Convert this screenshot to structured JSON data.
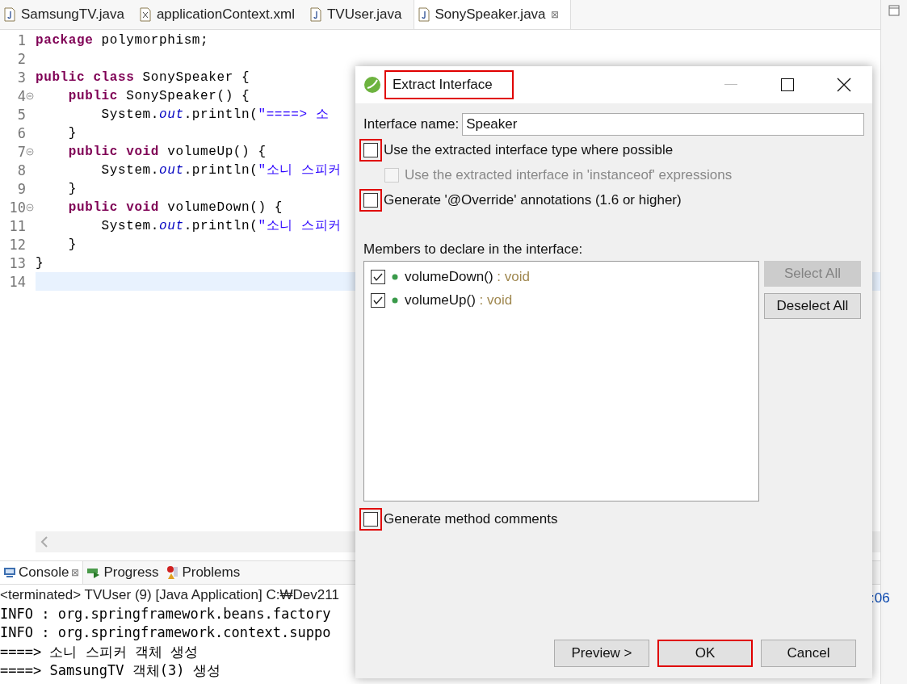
{
  "editor_tabs": [
    {
      "label": "SamsungTV.java",
      "kind": "java",
      "selected": false
    },
    {
      "label": "applicationContext.xml",
      "kind": "xml",
      "selected": false
    },
    {
      "label": "TVUser.java",
      "kind": "java",
      "selected": false
    },
    {
      "label": "SonySpeaker.java",
      "kind": "java",
      "selected": true,
      "close": "⊠"
    }
  ],
  "code_lines": [
    {
      "number": "1",
      "fold": false,
      "current": false,
      "tokens": [
        {
          "kind": "keyword",
          "text": "package"
        },
        {
          "kind": "plain",
          "text": " polymorphism;"
        }
      ]
    },
    {
      "number": "2",
      "fold": false,
      "current": false
    },
    {
      "number": "3",
      "fold": false,
      "current": false,
      "tokens": [
        {
          "kind": "keyword",
          "text": "public class"
        },
        {
          "kind": "plain",
          "text": " SonySpeaker {"
        }
      ]
    },
    {
      "number": "4",
      "fold": true,
      "current": false,
      "tokens": [
        {
          "kind": "keyword",
          "text": "    public"
        },
        {
          "kind": "plain",
          "text": " SonySpeaker() {"
        }
      ]
    },
    {
      "number": "5",
      "fold": false,
      "current": false,
      "tokens": [
        {
          "kind": "plain",
          "text": "        System."
        },
        {
          "kind": "field",
          "text": "out"
        },
        {
          "kind": "plain",
          "text": ".println("
        },
        {
          "kind": "string",
          "text": "\"====> 소"
        }
      ]
    },
    {
      "number": "6",
      "fold": false,
      "current": false,
      "tokens": [
        {
          "kind": "plain",
          "text": "    }"
        }
      ]
    },
    {
      "number": "7",
      "fold": true,
      "current": false,
      "tokens": [
        {
          "kind": "keyword",
          "text": "    public void"
        },
        {
          "kind": "plain",
          "text": " volumeUp() {"
        }
      ]
    },
    {
      "number": "8",
      "fold": false,
      "current": false,
      "tokens": [
        {
          "kind": "plain",
          "text": "        System."
        },
        {
          "kind": "field",
          "text": "out"
        },
        {
          "kind": "plain",
          "text": ".println("
        },
        {
          "kind": "string",
          "text": "\"소니 스피커"
        }
      ]
    },
    {
      "number": "9",
      "fold": false,
      "current": false,
      "tokens": [
        {
          "kind": "plain",
          "text": "    }"
        }
      ]
    },
    {
      "number": "10",
      "fold": true,
      "current": false,
      "tokens": [
        {
          "kind": "keyword",
          "text": "    public void"
        },
        {
          "kind": "plain",
          "text": " volumeDown() {"
        }
      ]
    },
    {
      "number": "11",
      "fold": false,
      "current": false,
      "tokens": [
        {
          "kind": "plain",
          "text": "        System."
        },
        {
          "kind": "field",
          "text": "out"
        },
        {
          "kind": "plain",
          "text": ".println("
        },
        {
          "kind": "string",
          "text": "\"소니 스피커"
        }
      ]
    },
    {
      "number": "12",
      "fold": false,
      "current": false,
      "tokens": [
        {
          "kind": "plain",
          "text": "    }"
        }
      ]
    },
    {
      "number": "13",
      "fold": false,
      "current": false,
      "tokens": [
        {
          "kind": "plain",
          "text": "}"
        }
      ]
    },
    {
      "number": "14",
      "fold": false,
      "current": true
    }
  ],
  "console_tabs": [
    {
      "label": "Console",
      "kind": "console",
      "selected": true,
      "close": "⊠"
    },
    {
      "label": "Progress",
      "kind": "progress",
      "selected": false
    },
    {
      "label": "Problems",
      "kind": "problems",
      "selected": false
    }
  ],
  "console": {
    "header": "<terminated> TVUser (9) [Java Application] C:₩Dev211",
    "time_fragment": ":06",
    "lines": [
      "INFO : org.springframework.beans.factory",
      "INFO : org.springframework.context.suppo",
      "====> 소니 스피커 객체 생성",
      "====> SamsungTV 객체(3) 생성"
    ]
  },
  "dialog": {
    "title": "Extract Interface",
    "title_highlighted": true,
    "name_label": "Interface name:",
    "name_value": "Speaker",
    "options": [
      {
        "label": "Use the extracted interface type where possible",
        "checked": false,
        "disabled": false,
        "indented": false,
        "highlighted": true
      },
      {
        "label": "Use the extracted interface in 'instanceof' expressions",
        "checked": false,
        "disabled": true,
        "indented": true,
        "highlighted": false
      },
      {
        "label": "Generate '@Override' annotations (1.6 or higher)",
        "checked": false,
        "disabled": false,
        "indented": false,
        "highlighted": true
      }
    ],
    "members_label": "Members to declare in the interface:",
    "members": [
      {
        "name": "volumeDown()",
        "type": " : void",
        "checked": true
      },
      {
        "name": "volumeUp()",
        "type": " : void",
        "checked": true
      }
    ],
    "side_buttons": [
      {
        "label": "Select All",
        "disabled": true
      },
      {
        "label": "Deselect All",
        "disabled": false
      }
    ],
    "comments_option": {
      "label": "Generate method comments",
      "checked": false,
      "highlighted": true
    },
    "buttons": [
      {
        "label": "Preview >",
        "highlighted": false
      },
      {
        "label": "OK",
        "highlighted": true
      },
      {
        "label": "Cancel",
        "highlighted": false
      }
    ]
  }
}
